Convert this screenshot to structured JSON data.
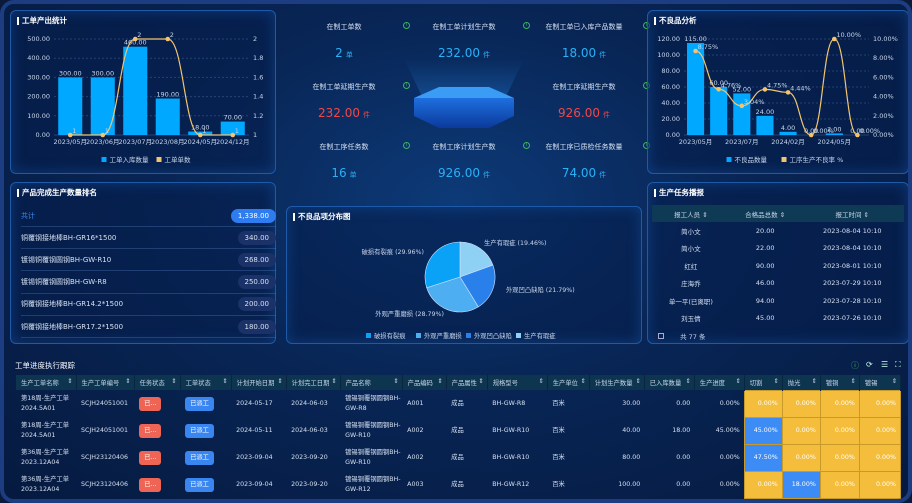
{
  "output_chart": {
    "title": "工单产出统计",
    "chart_data": {
      "type": "bar",
      "categories": [
        "2023/05月",
        "2023/06月",
        "2023/07月",
        "2023/08月",
        "2024/05月",
        "2024/12月"
      ],
      "series": [
        {
          "name": "工单入库数量",
          "type": "bar",
          "values": [
            300,
            300,
            460,
            190,
            18,
            70
          ],
          "labels": [
            "300.00",
            "300.00",
            "460.00",
            "190.00",
            "18.00",
            "70.00"
          ]
        },
        {
          "name": "工单单数",
          "type": "line",
          "values": [
            1,
            1,
            2,
            2,
            1,
            1
          ]
        }
      ],
      "ylim": [
        0,
        500
      ],
      "yticks": [
        "0.00",
        "100.00",
        "200.00",
        "300.00",
        "400.00",
        "500.00"
      ],
      "y2lim": [
        1,
        2
      ],
      "y2ticks": [
        "1",
        "1.2",
        "1.4",
        "1.6",
        "1.8",
        "2"
      ],
      "legend": "bottom",
      "colors": {
        "bar": "#00a8ff",
        "line": "#f3c46e"
      }
    }
  },
  "kpis": [
    {
      "label": "在制工单数",
      "value": "2",
      "unit": "单",
      "color": "blue"
    },
    {
      "label": "在制工单计划生产数",
      "value": "232.00",
      "unit": "件",
      "color": "blue"
    },
    {
      "label": "在制工单已入库产品数量",
      "value": "18.00",
      "unit": "件",
      "color": "blue"
    },
    {
      "label": "在制工单延期生产数",
      "value": "232.00",
      "unit": "件",
      "color": "red"
    },
    {
      "label": "在制工序延期生产数",
      "value": "926.00",
      "unit": "件",
      "color": "red"
    },
    {
      "label": "在制工序任务数",
      "value": "16",
      "unit": "单",
      "color": "blue"
    },
    {
      "label": "在制工序计划生产数",
      "value": "926.00",
      "unit": "件",
      "color": "blue"
    },
    {
      "label": "在制工序已质检任务数量",
      "value": "74.00",
      "unit": "件",
      "color": "blue"
    }
  ],
  "defect_chart": {
    "title": "不良品分析",
    "chart_data": {
      "type": "bar",
      "categories": [
        "2023/05月",
        "",
        "2023/07月",
        "",
        "2024/02月",
        "",
        "2024/05月",
        ""
      ],
      "series": [
        {
          "name": "不良品数量",
          "type": "bar",
          "values": [
            115,
            60,
            52,
            24,
            4,
            0,
            2,
            0
          ],
          "labels": [
            "115.00",
            "60.00",
            "52.00",
            "24.00",
            "4.00",
            "0.00",
            "2.00",
            "0.00"
          ]
        },
        {
          "name": "工序生产不良率 %",
          "type": "line",
          "values": [
            8.75,
            4.76,
            3.04,
            4.75,
            4.44,
            0,
            10,
            0
          ],
          "labels": [
            "8.75%",
            "4.76%",
            "3.04%",
            "4.75%",
            "4.44%",
            "0.00%",
            "10.00%",
            "0.00%"
          ]
        }
      ],
      "ylim": [
        0,
        120
      ],
      "yticks": [
        "0.00",
        "20.00",
        "40.00",
        "60.00",
        "80.00",
        "100.00",
        "120.00"
      ],
      "y2lim": [
        0,
        10
      ],
      "y2ticks": [
        "0.00%",
        "2.00%",
        "4.00%",
        "6.00%",
        "8.00%",
        "10.00%"
      ],
      "legend": "bottom"
    }
  },
  "ranking": {
    "title": "产品完成生产数量排名",
    "total_label": "共计",
    "total": "1,338.00",
    "items": [
      {
        "name": "铜覆钢接地棒BH-GR16*1500",
        "value": "340.00"
      },
      {
        "name": "镀锡铜覆钢圆钢BH-GW-R10",
        "value": "268.00"
      },
      {
        "name": "镀锡铜覆钢圆钢BH-GW-R8",
        "value": "250.00"
      },
      {
        "name": "铜覆钢接地棒BH-GR14.2*1500",
        "value": "200.00"
      },
      {
        "name": "铜覆钢接地棒BH-GR17.2*1500",
        "value": "180.00"
      }
    ]
  },
  "defect_dist": {
    "title": "不良品项分布图",
    "chart_data": {
      "type": "pie",
      "slices": [
        {
          "name": "生产有瑕疵",
          "value": 19.46,
          "label": "生产有瑕疵 (19.46%)",
          "color": "#8fd0f5"
        },
        {
          "name": "外观凹凸缺陷",
          "value": 21.79,
          "label": "外观凹凸缺陷 (21.79%)",
          "color": "#2a80ea"
        },
        {
          "name": "外观严重磨损",
          "value": 28.79,
          "label": "外观严重磨损 (28.79%)",
          "color": "#4eaef2"
        },
        {
          "name": "破损有裂痕",
          "value": 29.96,
          "label": "破损有裂痕 (29.96%)",
          "color": "#0aa2f7"
        }
      ],
      "legend_order": [
        "破损有裂痕",
        "外观严重磨损",
        "外观凹凸缺陷",
        "生产有瑕疵"
      ],
      "legend": "bottom"
    }
  },
  "report": {
    "title": "生产任务播报",
    "headers": [
      "报工人员",
      "合格品总数",
      "报工时间"
    ],
    "rows": [
      [
        "简小文",
        "20.00",
        "2023-08-04 10:10"
      ],
      [
        "简小文",
        "22.00",
        "2023-08-04 10:10"
      ],
      [
        "红红",
        "90.00",
        "2023-08-01 10:10"
      ],
      [
        "庄海乔",
        "46.00",
        "2023-07-29 10:10"
      ],
      [
        "单一平(已离职)",
        "94.00",
        "2023-07-28 10:10"
      ],
      [
        "刘玉倩",
        "45.00",
        "2023-07-26 10:10"
      ]
    ],
    "footer": "共 77 条"
  },
  "tracking": {
    "title": "工单进度执行跟踪",
    "headers": [
      "生产工单名称",
      "生产工单编号",
      "任务状态",
      "工单状态",
      "计划开始日期",
      "计划完工日期",
      "产品名称",
      "产品编码",
      "产品属性",
      "规格型号",
      "生产单位",
      "计划生产数量",
      "已入库数量",
      "生产进度",
      "切割",
      "抛光",
      "镀铜",
      "镀锡"
    ],
    "rows": [
      {
        "name": "第18周-生产工单2024.5A01",
        "code": "SCJH24051001",
        "task": "已...",
        "status": "已派工",
        "start": "2024-05-17",
        "end": "2024-06-03",
        "product": "镀锡铜覆钢圆钢BH-GW-R8",
        "pcode": "A001",
        "attr": "成品",
        "spec": "BH-GW-R8",
        "unit": "百米",
        "plan": "30.00",
        "stored": "0.00",
        "progress": "0.00%",
        "steps": [
          "0.00%",
          "0.00%",
          "0.00%",
          "0.00%"
        ],
        "hl": [
          0,
          0,
          0,
          0
        ]
      },
      {
        "name": "第18周-生产工单2024.5A01",
        "code": "SCJH24051001",
        "task": "已...",
        "status": "已派工",
        "start": "2024-05-11",
        "end": "2024-06-03",
        "product": "镀锡铜覆钢圆钢BH-GW-R10",
        "pcode": "A002",
        "attr": "成品",
        "spec": "BH-GW-R10",
        "unit": "百米",
        "plan": "40.00",
        "stored": "18.00",
        "progress": "45.00%",
        "steps": [
          "45.00%",
          "0.00%",
          "0.00%",
          "0.00%"
        ],
        "hl": [
          1,
          0,
          0,
          0
        ]
      },
      {
        "name": "第36周-生产工单2023.12A04",
        "code": "SCJH23120406",
        "task": "已...",
        "status": "已派工",
        "start": "2023-09-04",
        "end": "2023-09-20",
        "product": "镀锡铜覆钢圆钢BH-GW-R10",
        "pcode": "A002",
        "attr": "成品",
        "spec": "BH-GW-R10",
        "unit": "百米",
        "plan": "80.00",
        "stored": "0.00",
        "progress": "0.00%",
        "steps": [
          "47.50%",
          "0.00%",
          "0.00%",
          "0.00%"
        ],
        "hl": [
          1,
          0,
          0,
          0
        ]
      },
      {
        "name": "第36周-生产工单2023.12A04",
        "code": "SCJH23120406",
        "task": "已...",
        "status": "已派工",
        "start": "2023-09-04",
        "end": "2023-09-20",
        "product": "镀锡铜覆钢圆钢BH-GW-R12",
        "pcode": "A003",
        "attr": "成品",
        "spec": "BH-GW-R12",
        "unit": "百米",
        "plan": "100.00",
        "stored": "0.00",
        "progress": "0.00%",
        "steps": [
          "0.00%",
          "18.00%",
          "0.00%",
          "0.00%"
        ],
        "hl": [
          0,
          1,
          0,
          0
        ]
      }
    ]
  }
}
